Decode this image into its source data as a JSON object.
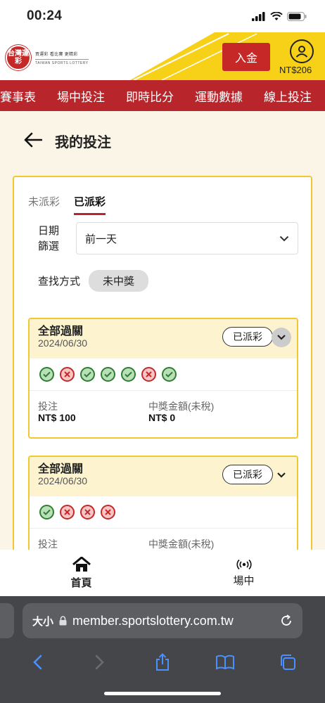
{
  "status": {
    "time": "00:24"
  },
  "header": {
    "logo_badge": "台灣運彩",
    "logo_line1": "買運彩 看比賽 更精彩",
    "logo_line2": "TAIWAN SPORTS LOTTERY",
    "deposit_label": "入金",
    "balance": "NT$206"
  },
  "nav": {
    "items": [
      "賽事表",
      "場中投注",
      "即時比分",
      "運動數據",
      "線上投注"
    ]
  },
  "page": {
    "title": "我的投注"
  },
  "tabs": {
    "pending": "未派彩",
    "settled": "已派彩"
  },
  "filter": {
    "label": "日期篩選",
    "value": "前一天"
  },
  "search": {
    "label": "查找方式",
    "chip": "未中獎"
  },
  "cards": [
    {
      "title": "全部過關",
      "date": "2024/06/30",
      "badge": "已派彩",
      "results": [
        "win",
        "lose",
        "win",
        "win",
        "win",
        "lose",
        "win"
      ],
      "stake_label": "投注",
      "stake": "NT$ 100",
      "prize_label": "中獎金額(未稅)",
      "prize": "NT$ 0"
    },
    {
      "title": "全部過關",
      "date": "2024/06/30",
      "badge": "已派彩",
      "results": [
        "win",
        "lose",
        "lose",
        "lose"
      ],
      "stake_label": "投注",
      "prize_label": "中獎金額(未稅)"
    }
  ],
  "bottom_nav": {
    "home": "首頁",
    "live": "場中"
  },
  "browser": {
    "text_size": "大小",
    "url": "member.sportslottery.com.tw"
  },
  "colors": {
    "brand_red": "#b8262b",
    "accent_yellow": "#f2c830",
    "win_green": "#2f7d32",
    "lose_red": "#c62828"
  }
}
